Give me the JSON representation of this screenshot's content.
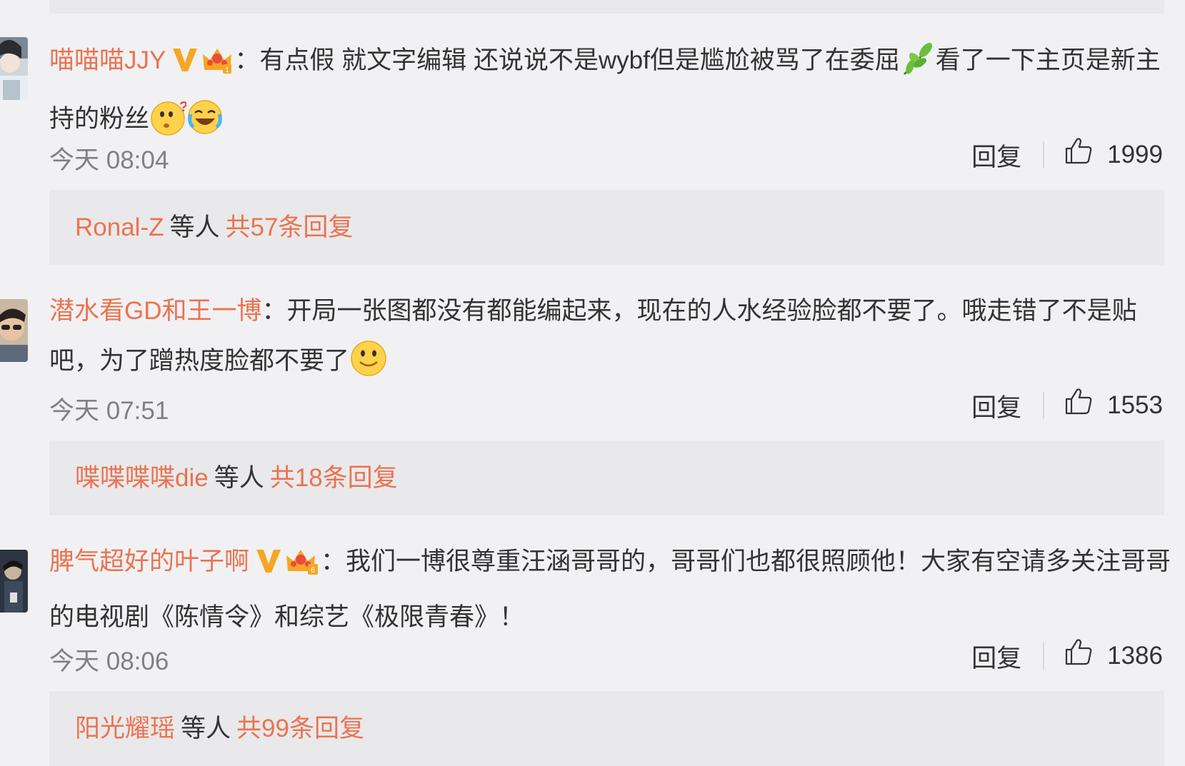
{
  "colors": {
    "background": "#f1f1f3",
    "reply_box": "#e9e9eb",
    "accent": "#eb7350",
    "text": "#333333",
    "muted": "#808080",
    "badge_gold": "#f5a623"
  },
  "comments": [
    {
      "username": "喵喵喵JJY",
      "separator": "：",
      "text_before_emoji": "有点假 就文字编辑 还说说不是wybf但是尴尬被骂了在委屈",
      "emoji_1": "leaf-emoji",
      "text_after_emoji": "看了一下主页是新主持的粉丝",
      "emoji_end": [
        "thinking-face-emoji",
        "laughing-crying-emoji"
      ],
      "time": "今天 08:04",
      "reply_label": "回复",
      "likes": "1999",
      "replies": {
        "who": "Ronal-Z",
        "etc": "等人",
        "count": "共57条回复"
      }
    },
    {
      "username": "潜水看GD和王一博",
      "separator": "：",
      "text": "开局一张图都没有都能编起来，现在的人水经验脸都不要了。哦走错了不是贴吧，为了蹭热度脸都不要了",
      "emoji_end": [
        "smile-emoji"
      ],
      "time": "今天 07:51",
      "reply_label": "回复",
      "likes": "1553",
      "replies": {
        "who": "喋喋喋喋die",
        "etc": "等人",
        "count": "共18条回复"
      }
    },
    {
      "username": "脾气超好的叶子啊",
      "separator": "：",
      "text": "我们一博很尊重汪涵哥哥的，哥哥们也都很照顾他！大家有空请多关注哥哥的电视剧《陈情令》和综艺《极限青春》！",
      "time": "今天 08:06",
      "reply_label": "回复",
      "likes": "1386",
      "replies": {
        "who": "阳光耀瑶",
        "etc": "等人",
        "count": "共99条回复"
      }
    }
  ]
}
